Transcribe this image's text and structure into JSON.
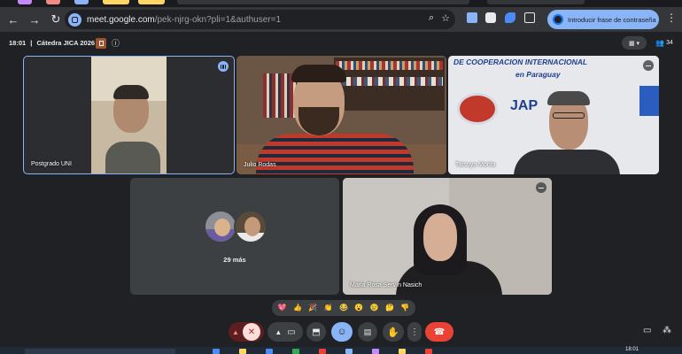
{
  "browser": {
    "url_host": "meet.google.com",
    "url_path": "/pek-njrg-okn?pli=1&authuser=1",
    "password_button_label": "Introducir frase de contraseña"
  },
  "meeting": {
    "time": "18:01",
    "separator": "|",
    "title": "Cátedra JICA 2026",
    "participant_count": "34"
  },
  "participants": [
    {
      "name": "Postgrado UNI"
    },
    {
      "name": "Julio Rodas"
    },
    {
      "name": "Tatsuya Morita"
    },
    {
      "name": "Maria Rosa Servín Nasich"
    }
  ],
  "more_tile": {
    "label": "29 más"
  },
  "background_sign": {
    "line1": "DE COOPERACION INTERNACIONAL",
    "line2": "en Paraguay",
    "logo": "JAP"
  },
  "reactions": [
    "💖",
    "👍",
    "🎉",
    "👏",
    "😂",
    "😮",
    "😢",
    "🤔",
    "👎"
  ],
  "icons": {
    "back": "arrow-left-icon",
    "forward": "arrow-right-icon",
    "reload": "reload-icon",
    "zoom": "zoom-icon",
    "bookmark": "star-icon",
    "mic": "mic-off-icon",
    "camera": "camera-icon",
    "present": "present-icon",
    "emoji": "emoji-icon",
    "captions": "captions-icon",
    "hand": "raise-hand-icon",
    "more": "more-options-icon",
    "leave": "end-call-icon",
    "chat": "chat-icon",
    "people": "people-icon"
  },
  "colors": {
    "page_bg": "#202124",
    "tile_bg": "#3c4043",
    "accent": "#8ab4f8",
    "leave_red": "#ea4335",
    "mic_off_bg": "#f9dedc",
    "emoji_active": "#8ab4f8"
  },
  "taskbar": {
    "clock": "18:01"
  }
}
